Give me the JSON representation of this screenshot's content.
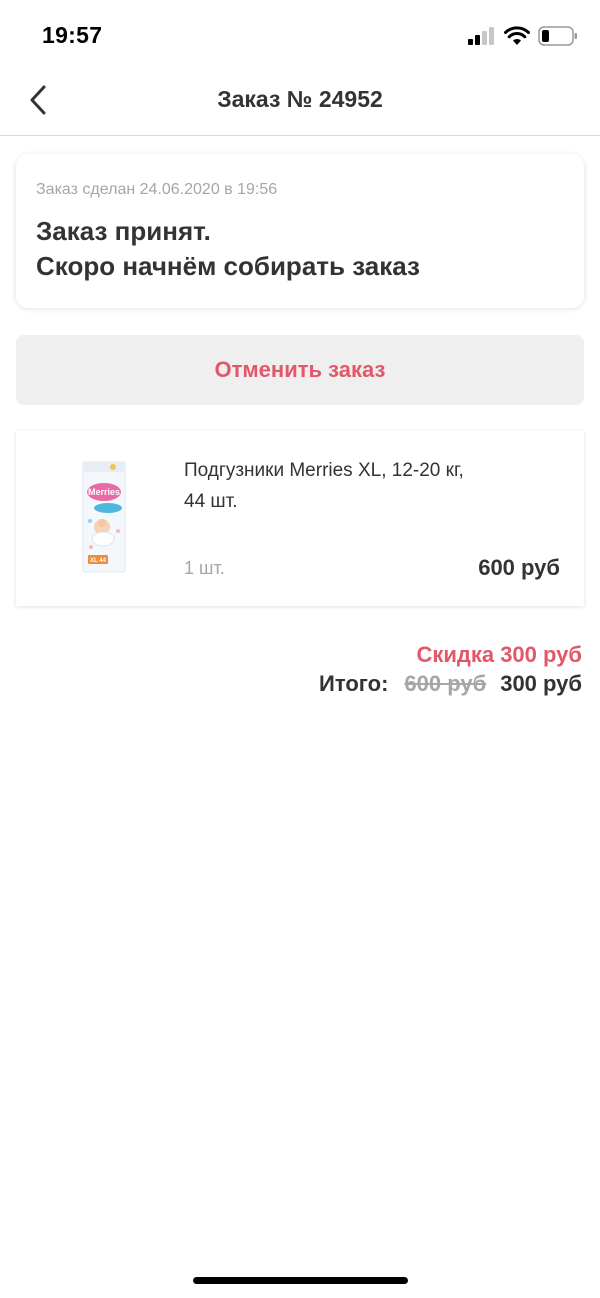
{
  "status_bar": {
    "time": "19:57"
  },
  "nav": {
    "title": "Заказ № 24952"
  },
  "order_status": {
    "date_text": "Заказ сделан 24.06.2020 в 19:56",
    "title_line1": "Заказ принят.",
    "title_line2": "Скоро начнём собирать заказ"
  },
  "cancel_button": {
    "label": "Отменить заказ"
  },
  "product": {
    "name_line1": "Подгузники Merries XL, 12-20 кг,",
    "name_line2": "44 шт.",
    "quantity": "1 шт.",
    "price": "600 руб",
    "image_brand": "Merries",
    "image_size": "XL 44"
  },
  "summary": {
    "discount": "Скидка 300 руб",
    "total_label": "Итого:",
    "old_price": "600 руб",
    "new_price": "300 руб"
  },
  "colors": {
    "accent": "#e25769",
    "text": "#333333",
    "muted": "#a6a6a6"
  },
  "icons": [
    "signal-icon",
    "wifi-icon",
    "battery-icon",
    "back-arrow-icon"
  ]
}
